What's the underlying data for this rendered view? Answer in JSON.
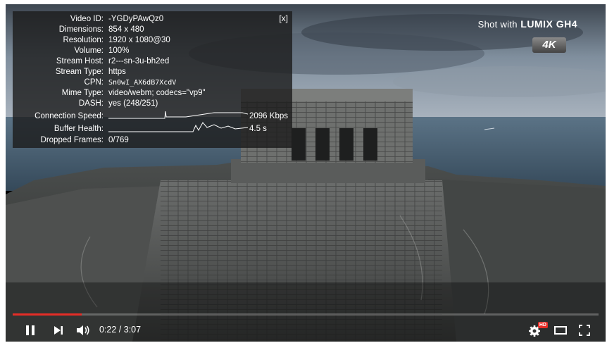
{
  "stats": {
    "close_label": "[x]",
    "rows": [
      {
        "label": "Video ID:",
        "value": "-YGDyPAwQz0"
      },
      {
        "label": "Dimensions:",
        "value": "854 x 480"
      },
      {
        "label": "Resolution:",
        "value": "1920 x 1080@30"
      },
      {
        "label": "Volume:",
        "value": "100%"
      },
      {
        "label": "Stream Host:",
        "value": "r2---sn-3u-bh2ed"
      },
      {
        "label": "Stream Type:",
        "value": "https"
      },
      {
        "label": "CPN:",
        "value": "Sn0wI_AX6dB7XcdV"
      },
      {
        "label": "Mime Type:",
        "value": "video/webm; codecs=\"vp9\""
      },
      {
        "label": "DASH:",
        "value": "yes (248/251)"
      }
    ],
    "connection_speed": {
      "label": "Connection Speed:",
      "value": "2096 Kbps"
    },
    "buffer_health": {
      "label": "Buffer Health:",
      "value": "4.5 s"
    },
    "dropped_frames": {
      "label": "Dropped Frames:",
      "value": "0/769"
    }
  },
  "watermark": {
    "prefix": "Shot with",
    "brand": "LUMIX GH4",
    "badge": "4K"
  },
  "controls": {
    "time": "0:22 / 3:07",
    "progress_fraction": 0.118,
    "hd_badge": "HD"
  },
  "colors": {
    "progress": "#e52d27",
    "hd_badge": "#e52d27"
  }
}
